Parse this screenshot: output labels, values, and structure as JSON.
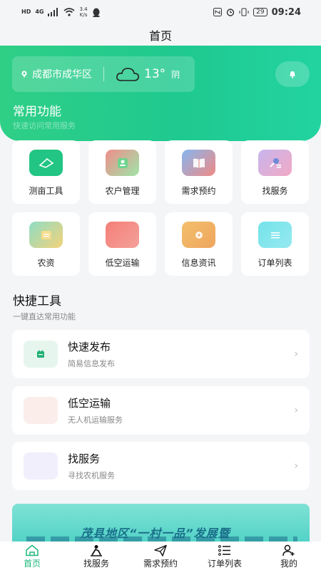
{
  "status_bar": {
    "network_type": "HD",
    "signal": "4G",
    "net_speed_value": "3.4",
    "net_speed_unit": "K/s",
    "battery": "29",
    "time": "09:24"
  },
  "header": {
    "title": "首页"
  },
  "hero": {
    "location": "成都市成华区",
    "temperature": "13°",
    "weather": "阴",
    "section_title": "常用功能",
    "section_subtitle": "快速访问常用服务"
  },
  "functions": [
    {
      "label": "测亩工具",
      "icon": "measure-icon",
      "color": "#22c584"
    },
    {
      "label": "农户管理",
      "icon": "farmer-icon",
      "color": "#e88a86"
    },
    {
      "label": "需求预约",
      "icon": "book-icon",
      "color": "#7eb0ec"
    },
    {
      "label": "找服务",
      "icon": "service-icon",
      "color": "#b7a7ea"
    },
    {
      "label": "农资",
      "icon": "supplies-icon",
      "color": "#8fddc4"
    },
    {
      "label": "低空运输",
      "icon": "drone-icon",
      "color": "#f07f78"
    },
    {
      "label": "信息资讯",
      "icon": "info-icon",
      "color": "#f1b968"
    },
    {
      "label": "订单列表",
      "icon": "list-icon",
      "color": "#6fdfe6"
    }
  ],
  "quick_tools": {
    "title": "快捷工具",
    "subtitle": "一键直达常用功能",
    "items": [
      {
        "title": "快速发布",
        "subtitle": "简易信息发布",
        "icon": "publish-icon",
        "color": "#e6f6ee"
      },
      {
        "title": "低空运输",
        "subtitle": "无人机运输服务",
        "icon": "drone-icon",
        "color": "#fbeeea"
      },
      {
        "title": "找服务",
        "subtitle": "寻找农机服务",
        "icon": "service-icon",
        "color": "#f1effc"
      }
    ]
  },
  "banner": {
    "text": "茂县地区“一村一品”发展暨"
  },
  "tabs": [
    {
      "label": "首页",
      "icon": "home-icon",
      "active": true
    },
    {
      "label": "找服务",
      "icon": "worker-icon",
      "active": false
    },
    {
      "label": "需求预约",
      "icon": "send-icon",
      "active": false
    },
    {
      "label": "订单列表",
      "icon": "list-icon",
      "active": false
    },
    {
      "label": "我的",
      "icon": "user-icon",
      "active": false
    }
  ],
  "colors": {
    "primary": "#22c985",
    "active_tab": "#1fb87c"
  }
}
